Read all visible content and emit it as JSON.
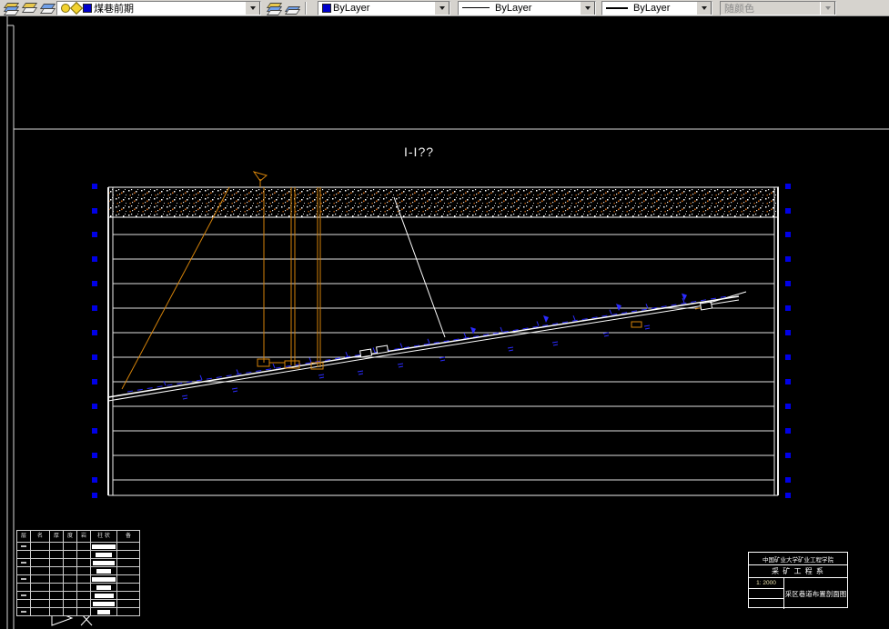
{
  "toolbar": {
    "layer": {
      "value": "煤巷前期"
    },
    "color": {
      "value": "ByLayer"
    },
    "linetype": {
      "value": "ByLayer"
    },
    "lineweight": {
      "value": "ByLayer"
    },
    "plot_style": {
      "value": "随颜色"
    }
  },
  "drawing": {
    "section_label": "I-I??",
    "title_block": {
      "institute": "中国矿业大学矿业工程学院",
      "department": "采 矿 工 程 系",
      "scale": "1: 2000",
      "title": "采区巷道布置剖面图"
    },
    "strata_table": {
      "headers": [
        "层",
        "名",
        "厚",
        "度",
        "岩",
        "柱 状",
        "备"
      ]
    }
  },
  "colors": {
    "grip_blue": "#0000e6",
    "roadway_blue": "#2b2bff",
    "shaft_orange": "#d4820a",
    "line_white": "#e0e0e0"
  }
}
